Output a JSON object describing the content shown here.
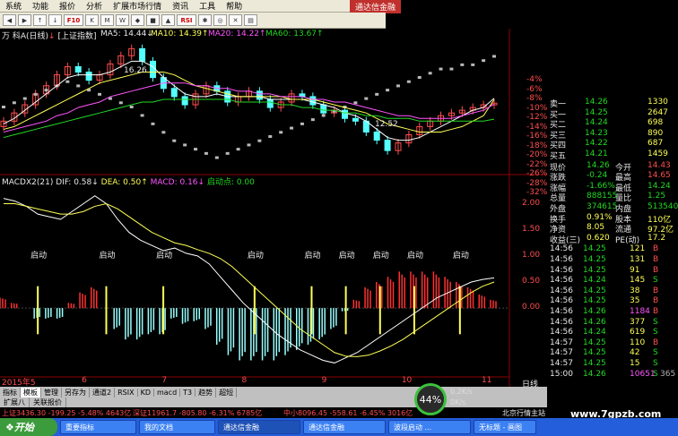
{
  "menu": [
    "系统",
    "功能",
    "报价",
    "分析",
    "扩展市场行情",
    "资讯",
    "工具",
    "帮助"
  ],
  "app_title": "通达信金融",
  "toolbar": {
    "buttons": [
      "◀",
      "▶",
      "↑",
      "↓",
      "F10",
      "K",
      "M",
      "W",
      "◆",
      "■",
      "▲",
      "RSI",
      "✱",
      "◎",
      "✕",
      "▤"
    ]
  },
  "chart_header": {
    "name": "万 科A(日线)",
    "arrow": "↓",
    "ref": "[上证指数]",
    "ma5": "MA5: 14.44↓",
    "ma10": "MA10: 14.39↑",
    "ma20": "MA20: 14.22↑",
    "ma60": "MA60: 13.67↑"
  },
  "price_labels": {
    "high": "16.26",
    "low": "12.52"
  },
  "pct_scale": [
    "-4%",
    "-6%",
    "-8%",
    "-10%",
    "-12%",
    "-14%",
    "-16%",
    "-18%",
    "-20%",
    "-22%",
    "-26%",
    "-28%",
    "-32%"
  ],
  "macd_header": {
    "name": "MACDX2(21)",
    "dif": "DIF: 0.58↓",
    "dea": "DEA: 0.50↑",
    "macd": "MACD: 0.16↓",
    "start": "启动点: 0.00"
  },
  "macd_scale": [
    "2.00",
    "1.50",
    "1.00",
    "0.50",
    "0.00"
  ],
  "start_markers": [
    "启动",
    "启动",
    "启动",
    "启动",
    "启动",
    "启动",
    "启动",
    "启动",
    "启动"
  ],
  "x_axis": {
    "first": "2015年5",
    "months": [
      "6",
      "7",
      "8",
      "9",
      "10",
      "11"
    ]
  },
  "period": "日线",
  "order_book": {
    "sells": [
      {
        "label": "卖一",
        "price": "14.26",
        "vol": "1330"
      }
    ],
    "buys": [
      {
        "label": "买一",
        "price": "14.25",
        "vol": "2647"
      },
      {
        "label": "买二",
        "price": "14.24",
        "vol": "698"
      },
      {
        "label": "买三",
        "price": "14.23",
        "vol": "890"
      },
      {
        "label": "买四",
        "price": "14.22",
        "vol": "687"
      },
      {
        "label": "买五",
        "price": "14.21",
        "vol": "1459"
      }
    ]
  },
  "stats": [
    {
      "l1": "现价",
      "v1": "14.26",
      "l2": "今开",
      "v2": "14.43"
    },
    {
      "l1": "涨跌",
      "v1": "-0.24",
      "l2": "最高",
      "v2": "14.65"
    },
    {
      "l1": "涨幅",
      "v1": "-1.66%",
      "l2": "最低",
      "v2": "14.24"
    },
    {
      "l1": "总量",
      "v1": "888155",
      "l2": "量比",
      "v2": "1.25"
    },
    {
      "l1": "外盘",
      "v1": "374615",
      "l2": "内盘",
      "v2": "513540"
    },
    {
      "l1": "换手",
      "v1": "0.91%",
      "l2": "股本",
      "v2": "110亿"
    },
    {
      "l1": "净资",
      "v1": "8.05",
      "l2": "流通",
      "v2": "97.2亿"
    },
    {
      "l1": "收益(三)",
      "v1": "0.620",
      "l2": "PE(动)",
      "v2": "17.2"
    }
  ],
  "ticks": [
    {
      "time": "14:56",
      "price": "14.25",
      "vol": "121",
      "side": "B"
    },
    {
      "time": "14:56",
      "price": "14.25",
      "vol": "131",
      "side": "B"
    },
    {
      "time": "14:56",
      "price": "14.25",
      "vol": "91",
      "side": "B"
    },
    {
      "time": "14:56",
      "price": "14.24",
      "vol": "145",
      "side": "S"
    },
    {
      "time": "14:56",
      "price": "14.25",
      "vol": "38",
      "side": "B"
    },
    {
      "time": "14:56",
      "price": "14.25",
      "vol": "35",
      "side": "B"
    },
    {
      "time": "14:56",
      "price": "14.26",
      "vol": "1184",
      "side": "B"
    },
    {
      "time": "14:56",
      "price": "14.26",
      "vol": "377",
      "side": "S"
    },
    {
      "time": "14:56",
      "price": "14.24",
      "vol": "619",
      "side": "S"
    },
    {
      "time": "14:57",
      "price": "14.25",
      "vol": "110",
      "side": "B"
    },
    {
      "time": "14:57",
      "price": "14.25",
      "vol": "42",
      "side": "S"
    },
    {
      "time": "14:57",
      "price": "14.25",
      "vol": "15",
      "side": "S"
    },
    {
      "time": "15:00",
      "price": "14.26",
      "vol": "10651",
      "side": "S"
    }
  ],
  "tick_extra": "365",
  "tabs": [
    "指标",
    "模板",
    "管理",
    "另存为",
    "通道2",
    "RSIX",
    "KD",
    "macd",
    "T3",
    "趋势",
    "超短"
  ],
  "subtabs": [
    "扩展八",
    "关联报价"
  ],
  "index_bar": [
    {
      "text": "上证3436.30 -199.25 -5.48% 4643亿",
      "color": "red"
    },
    {
      "text": "深证11961.7 -805.80 -6.31% 6785亿",
      "color": "red"
    },
    {
      "text": "中小8096.45 -558.61 -6.45% 3016亿",
      "color": "red"
    },
    {
      "text": "北京行情主站",
      "color": "white"
    }
  ],
  "gauge": {
    "value": "44%",
    "up": "0.2K/s",
    "down": "0K/s"
  },
  "watermark": "www.7gpzb.com",
  "taskbar": {
    "start": "开始",
    "tasks": [
      "重要指标",
      "我的文档",
      "通达信金融",
      "通达信金融",
      "波段启动 ...",
      "无标题 - 画图"
    ]
  },
  "colors": {
    "up": "#ff4d4d",
    "down": "#22d822",
    "ma5": "#ffffff",
    "ma10": "#ffff55",
    "ma20": "#ff55ff",
    "ma60": "#22d822",
    "accent": "#c0302c"
  },
  "chart_data": {
    "type": "line",
    "title": "万 科A(日线)",
    "price_panel": {
      "ylim": [
        12.0,
        16.6
      ],
      "close_series": [
        13.6,
        13.9,
        14.2,
        14.6,
        14.9,
        15.3,
        15.6,
        15.4,
        15.1,
        15.3,
        15.7,
        16.0,
        16.26,
        15.8,
        15.2,
        14.8,
        14.5,
        14.2,
        14.6,
        14.9,
        14.7,
        14.3,
        14.5,
        14.7,
        14.4,
        14.1,
        14.3,
        14.6,
        14.5,
        14.2,
        13.9,
        14.0,
        13.7,
        13.6,
        13.2,
        12.9,
        12.52,
        12.8,
        13.1,
        13.4,
        13.6,
        13.8,
        13.9,
        14.0,
        14.1,
        14.2,
        14.26
      ],
      "ma_series": [
        {
          "name": "MA5",
          "values": [
            13.5,
            13.7,
            14.0,
            14.3,
            14.6,
            14.9,
            15.2,
            15.3,
            15.3,
            15.3,
            15.4,
            15.6,
            15.8,
            15.8,
            15.6,
            15.2,
            14.9,
            14.6,
            14.5,
            14.5,
            14.6,
            14.5,
            14.5,
            14.5,
            14.5,
            14.4,
            14.4,
            14.4,
            14.4,
            14.3,
            14.2,
            14.1,
            13.9,
            13.8,
            13.6,
            13.3,
            13.0,
            12.9,
            12.9,
            13.0,
            13.2,
            13.4,
            13.6,
            13.8,
            14.0,
            14.1,
            14.44
          ]
        },
        {
          "name": "MA10",
          "values": [
            13.3,
            13.4,
            13.6,
            13.8,
            14.0,
            14.2,
            14.4,
            14.6,
            14.8,
            15.0,
            15.1,
            15.2,
            15.3,
            15.4,
            15.4,
            15.4,
            15.3,
            15.1,
            14.9,
            14.8,
            14.7,
            14.6,
            14.5,
            14.5,
            14.5,
            14.5,
            14.5,
            14.4,
            14.4,
            14.4,
            14.3,
            14.2,
            14.1,
            14.0,
            13.9,
            13.7,
            13.5,
            13.4,
            13.3,
            13.2,
            13.2,
            13.2,
            13.3,
            13.4,
            13.6,
            13.8,
            14.39
          ]
        },
        {
          "name": "MA20",
          "values": [
            13.2,
            13.3,
            13.4,
            13.5,
            13.6,
            13.8,
            13.9,
            14.1,
            14.2,
            14.3,
            14.5,
            14.6,
            14.7,
            14.8,
            14.9,
            15.0,
            15.0,
            15.0,
            14.9,
            14.9,
            14.8,
            14.8,
            14.7,
            14.7,
            14.6,
            14.6,
            14.5,
            14.5,
            14.5,
            14.4,
            14.4,
            14.3,
            14.3,
            14.2,
            14.1,
            14.0,
            13.9,
            13.8,
            13.8,
            13.7,
            13.7,
            13.7,
            13.7,
            13.8,
            13.9,
            14.0,
            14.22
          ]
        },
        {
          "name": "MA60",
          "values": [
            13.0,
            13.1,
            13.2,
            13.3,
            13.4,
            13.5,
            13.6,
            13.7,
            13.8,
            13.9,
            14.0,
            14.1,
            14.2,
            14.3,
            14.3,
            14.4,
            14.4,
            14.4,
            14.4,
            14.4,
            14.4,
            14.4,
            14.3,
            14.3,
            14.3,
            14.3,
            14.2,
            14.2,
            14.1,
            14.1,
            14.0,
            14.0,
            13.9,
            13.9,
            13.8,
            13.8,
            13.7,
            13.7,
            13.7,
            13.6,
            13.6,
            13.6,
            13.6,
            13.6,
            13.6,
            13.6,
            13.67
          ]
        }
      ],
      "ref_index_pct": [
        -18,
        -17,
        -16,
        -15,
        -14,
        -13,
        -12,
        -13,
        -14,
        -15,
        -16,
        -17,
        -18,
        -20,
        -22,
        -24,
        -26,
        -27,
        -28,
        -29,
        -30,
        -29,
        -28,
        -27,
        -26,
        -25,
        -24,
        -23,
        -22,
        -21,
        -20,
        -19,
        -18,
        -17,
        -16,
        -15,
        -14,
        -13,
        -12,
        -11,
        -10,
        -9,
        -9,
        -8,
        -8,
        -7,
        -6
      ]
    },
    "macd_panel": {
      "ylim": [
        -1.3,
        2.3
      ],
      "dif": [
        2.1,
        2.05,
        1.95,
        1.8,
        1.75,
        1.7,
        1.85,
        2.0,
        2.15,
        2.0,
        1.7,
        1.45,
        1.3,
        1.2,
        1.1,
        1.15,
        1.05,
        1.0,
        0.85,
        0.6,
        0.35,
        0.1,
        -0.1,
        -0.3,
        -0.5,
        -0.65,
        -0.8,
        -0.9,
        -1.0,
        -1.05,
        -0.95,
        -0.85,
        -0.7,
        -0.55,
        -0.4,
        -0.25,
        -0.1,
        0.05,
        0.2,
        0.3,
        0.4,
        0.5,
        0.55,
        0.58
      ],
      "dea": [
        2.0,
        2.0,
        1.95,
        1.9,
        1.85,
        1.8,
        1.8,
        1.85,
        1.95,
        2.0,
        1.9,
        1.75,
        1.6,
        1.45,
        1.35,
        1.25,
        1.2,
        1.12,
        1.05,
        0.95,
        0.8,
        0.6,
        0.4,
        0.2,
        0.0,
        -0.2,
        -0.4,
        -0.55,
        -0.7,
        -0.85,
        -0.92,
        -0.93,
        -0.9,
        -0.82,
        -0.72,
        -0.6,
        -0.45,
        -0.3,
        -0.15,
        0.0,
        0.15,
        0.3,
        0.42,
        0.5
      ],
      "macd": [
        0.2,
        0.1,
        0.0,
        -0.2,
        -0.2,
        -0.2,
        0.1,
        0.3,
        0.4,
        0.0,
        -0.4,
        -0.6,
        -0.6,
        -0.5,
        -0.5,
        -0.2,
        -0.3,
        -0.25,
        -0.4,
        -0.7,
        -0.9,
        -1.0,
        -1.0,
        -1.0,
        -1.0,
        -0.9,
        -0.8,
        -0.7,
        -0.6,
        -0.4,
        -0.06,
        0.16,
        0.4,
        0.5,
        0.6,
        0.7,
        0.7,
        0.7,
        0.7,
        0.6,
        0.5,
        0.4,
        0.26,
        0.16
      ],
      "start_points": [
        3,
        9,
        14,
        22,
        27,
        30,
        33,
        36,
        40
      ]
    },
    "xlabels": [
      "2015年5",
      "6",
      "7",
      "8",
      "9",
      "10",
      "11"
    ]
  }
}
